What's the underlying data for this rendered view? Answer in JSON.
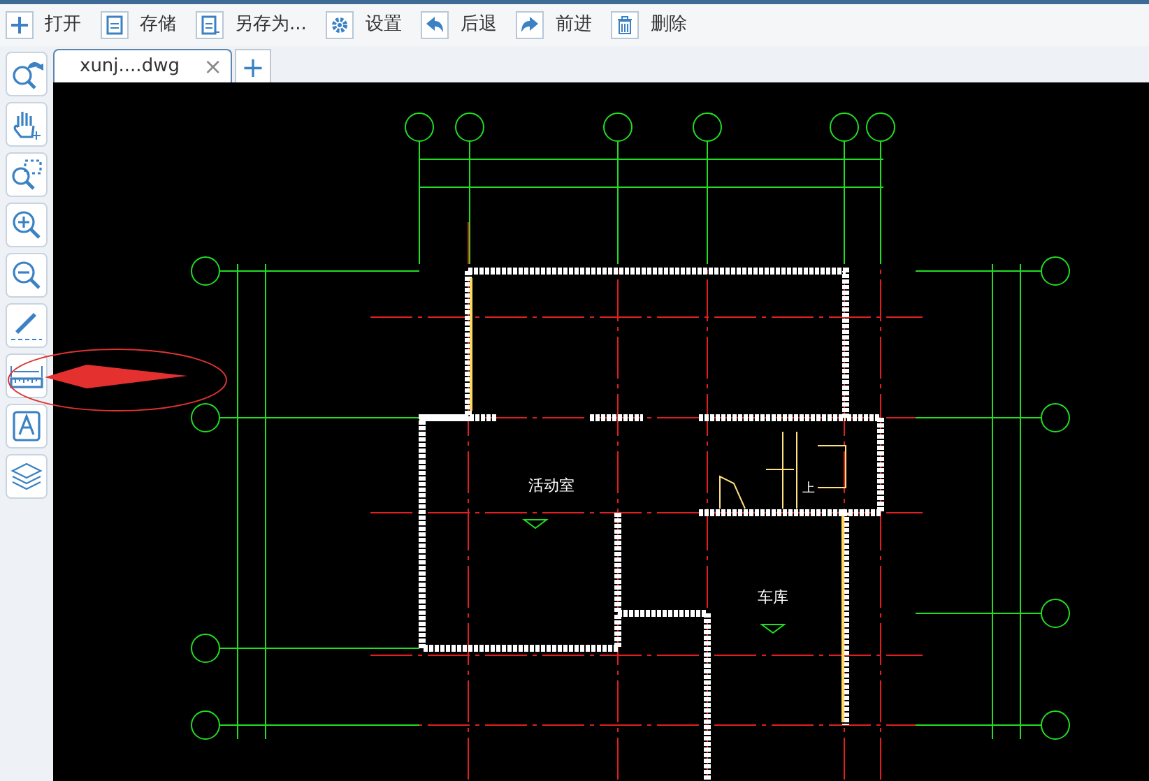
{
  "toolbar": [
    {
      "kind": "open",
      "label": "打开"
    },
    {
      "kind": "save",
      "label": "存储"
    },
    {
      "kind": "save-as",
      "label": "另存为..."
    },
    {
      "kind": "settings",
      "label": "设置"
    },
    {
      "kind": "back",
      "label": "后退"
    },
    {
      "kind": "forward",
      "label": "前进"
    },
    {
      "kind": "delete",
      "label": "删除"
    }
  ],
  "tabs": [
    {
      "label": "xunj....dwg",
      "selected": true,
      "close": "×"
    }
  ],
  "new_tab": "+",
  "tools": [
    {
      "kind": "zoom-previous"
    },
    {
      "kind": "pan"
    },
    {
      "kind": "zoom-window"
    },
    {
      "kind": "zoom-in"
    },
    {
      "kind": "zoom-out"
    },
    {
      "kind": "draw"
    },
    {
      "kind": "measure"
    },
    {
      "kind": "text"
    },
    {
      "kind": "layers"
    }
  ],
  "drawing": {
    "rooms": [
      "活动室",
      "车库"
    ],
    "stair_label": "上"
  }
}
